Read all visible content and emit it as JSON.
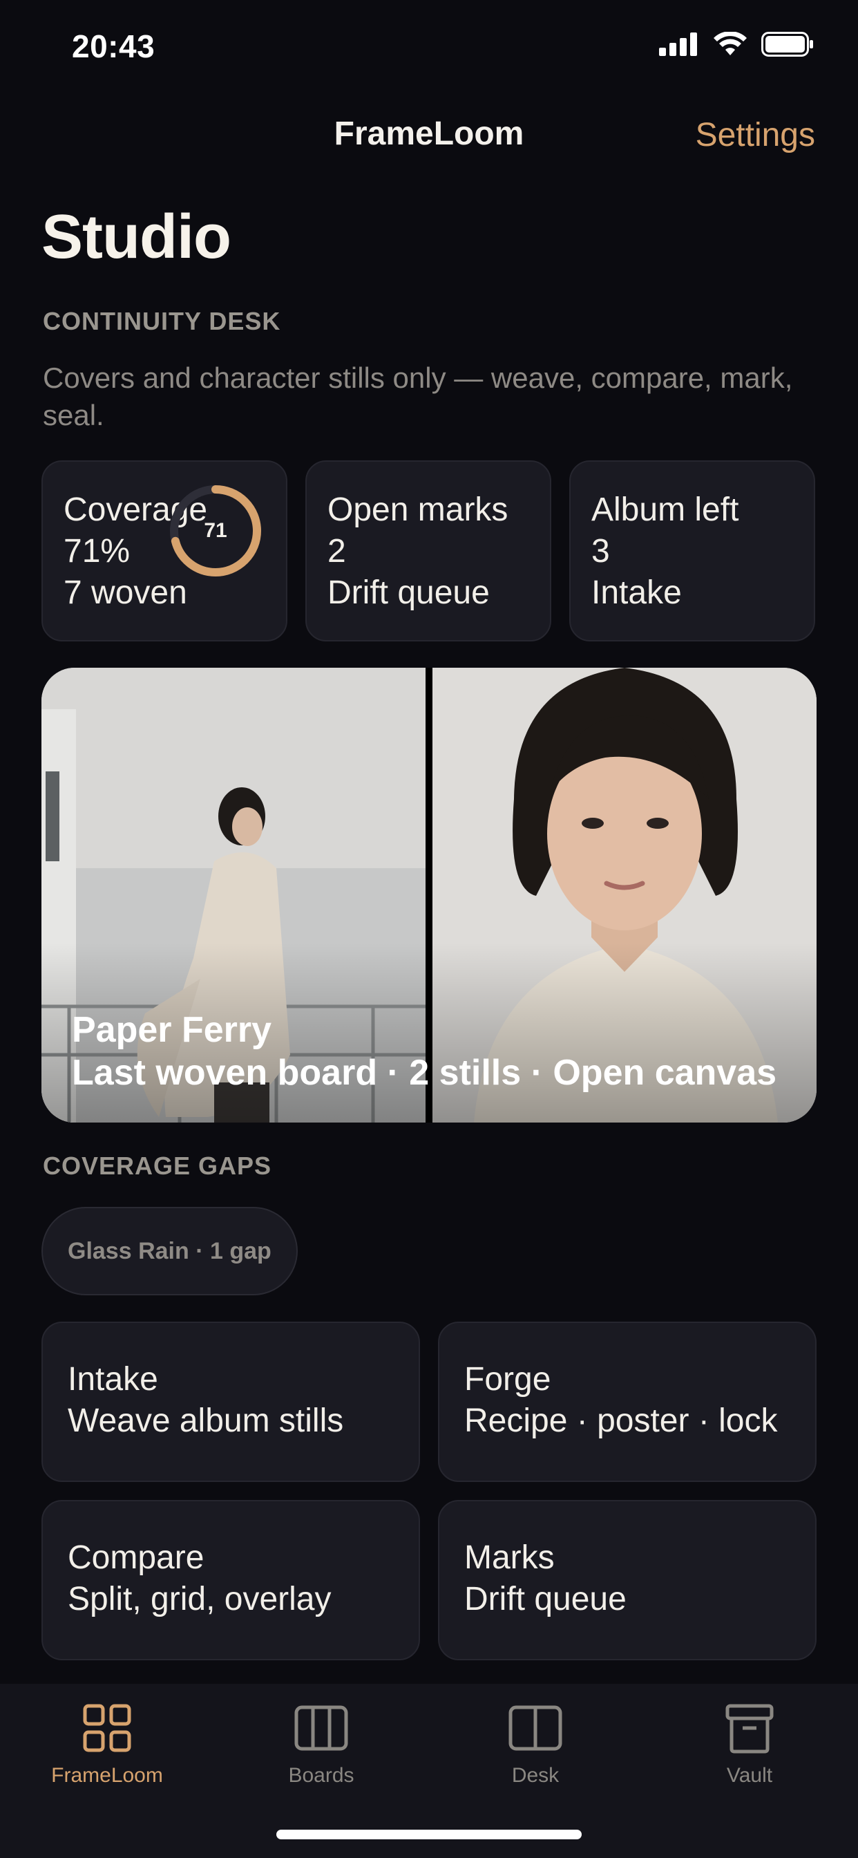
{
  "status_bar": {
    "time": "20:43"
  },
  "nav": {
    "title": "FrameLoom",
    "settings_label": "Settings"
  },
  "page": {
    "title": "Studio",
    "section_label": "CONTINUITY DESK",
    "subtitle": "Covers and character stills only — weave, compare, mark, seal."
  },
  "stats": [
    {
      "label": "Coverage",
      "value": "71%",
      "detail": "7 woven",
      "ring_value": "71",
      "ring_percent": 71
    },
    {
      "label": "Open marks",
      "value": "2",
      "detail": "Drift queue"
    },
    {
      "label": "Album left",
      "value": "3",
      "detail": "Intake"
    }
  ],
  "hero": {
    "title": "Paper Ferry",
    "subtitle": "Last woven board · 2 stills · Open canvas"
  },
  "gaps": {
    "section_label": "COVERAGE GAPS",
    "chip": "Glass Rain · 1 gap"
  },
  "actions": [
    {
      "title": "Intake",
      "subtitle": "Weave album stills"
    },
    {
      "title": "Forge",
      "subtitle": "Recipe · poster · lock"
    },
    {
      "title": "Compare",
      "subtitle": "Split, grid, overlay"
    },
    {
      "title": "Marks",
      "subtitle": "Drift queue"
    }
  ],
  "tabs": [
    {
      "label": "FrameLoom",
      "icon": "grid-icon",
      "active": true
    },
    {
      "label": "Boards",
      "icon": "boards-icon",
      "active": false
    },
    {
      "label": "Desk",
      "icon": "desk-icon",
      "active": false
    },
    {
      "label": "Vault",
      "icon": "archive-icon",
      "active": false
    }
  ],
  "colors": {
    "background": "#0b0b10",
    "card": "#1a1a22",
    "accent": "#d7a36e",
    "muted_text": "#8e8a85"
  }
}
